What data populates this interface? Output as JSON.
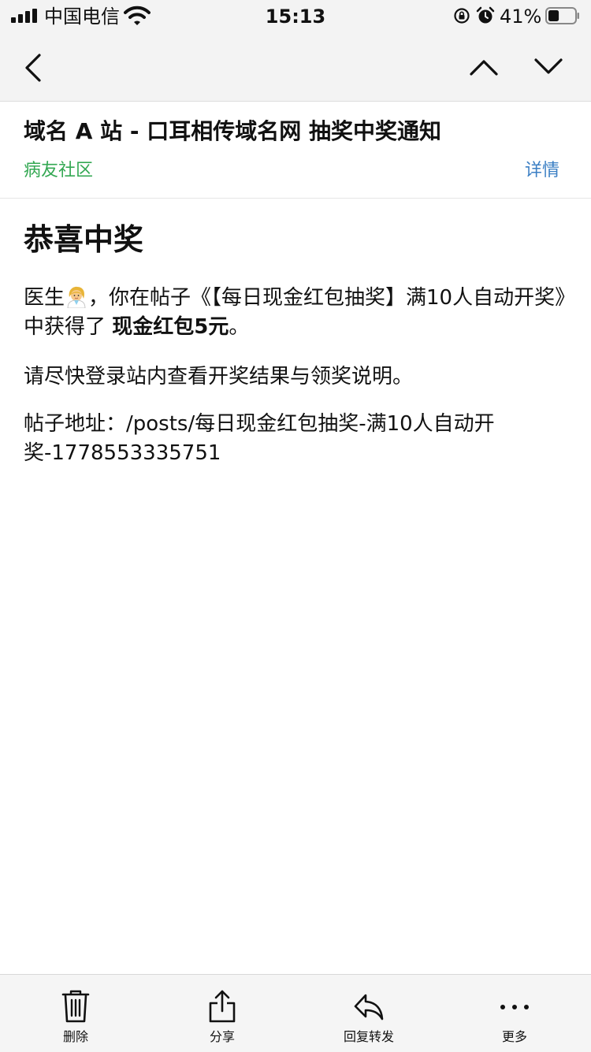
{
  "status_bar": {
    "carrier": "中国电信",
    "time": "15:13",
    "battery_percent": "41%",
    "battery_level": 0.41,
    "icons": [
      "signal-icon",
      "wifi-icon",
      "rotation-lock-icon",
      "alarm-icon",
      "battery-icon"
    ]
  },
  "nav": {
    "icons": [
      "back-icon",
      "previous-icon",
      "next-icon"
    ]
  },
  "header": {
    "subject": "域名 A 站 - 口耳相传域名网 抽奖中奖通知",
    "sender": "病友社区",
    "details_link": "详情"
  },
  "content": {
    "heading": "恭喜中奖",
    "p1_prefix": "医生",
    "p1_mid": "，你在帖子《【每日现金红包抽奖】满10人自动开奖》中获得了 ",
    "p1_bold": "现金红包5元",
    "p1_suffix": "。",
    "p2": "请尽快登录站内查看开奖结果与领奖说明。",
    "p3": "帖子地址：/posts/每日现金红包抽奖-满10人自动开奖-1778553335751"
  },
  "toolbar": {
    "delete_label": "删除",
    "share_label": "分享",
    "reply_label": "回复转发",
    "more_label": "更多"
  },
  "colors": {
    "sender": "#34a853",
    "link": "#3b7fc4",
    "bar_background": "#f3f3f3"
  }
}
